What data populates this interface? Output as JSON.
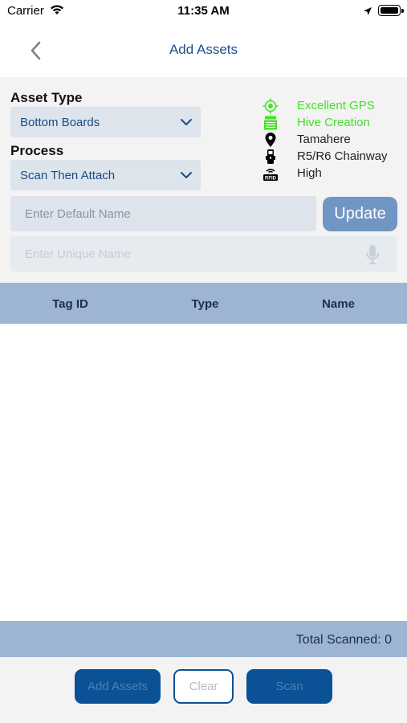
{
  "status_bar": {
    "carrier": "Carrier",
    "time": "11:35 AM"
  },
  "nav": {
    "title": "Add Assets",
    "accent_color": "#1d4f8e"
  },
  "form": {
    "asset_type_label": "Asset Type",
    "asset_type_value": "Bottom Boards",
    "process_label": "Process",
    "process_value": "Scan Then Attach",
    "default_name_placeholder": "Enter Default Name",
    "unique_name_placeholder": "Enter Unique Name",
    "update_label": "Update"
  },
  "info": {
    "gps": {
      "icon": "gps-target-icon",
      "text": "Excellent GPS",
      "color": "#44e02a"
    },
    "mode": {
      "icon": "hive-icon",
      "text": "Hive Creation",
      "color": "#44e02a"
    },
    "location": {
      "icon": "map-pin-icon",
      "text": "Tamahere"
    },
    "reader": {
      "icon": "rfid-reader-icon",
      "text": "R5/R6 Chainway"
    },
    "power": {
      "icon": "rfid-icon",
      "text": "High"
    }
  },
  "table": {
    "columns": [
      "Tag ID",
      "Type",
      "Name"
    ],
    "rows": []
  },
  "footer": {
    "total_scanned": "Total Scanned: 0",
    "add_assets_label": "Add Assets",
    "clear_label": "Clear",
    "scan_label": "Scan"
  }
}
